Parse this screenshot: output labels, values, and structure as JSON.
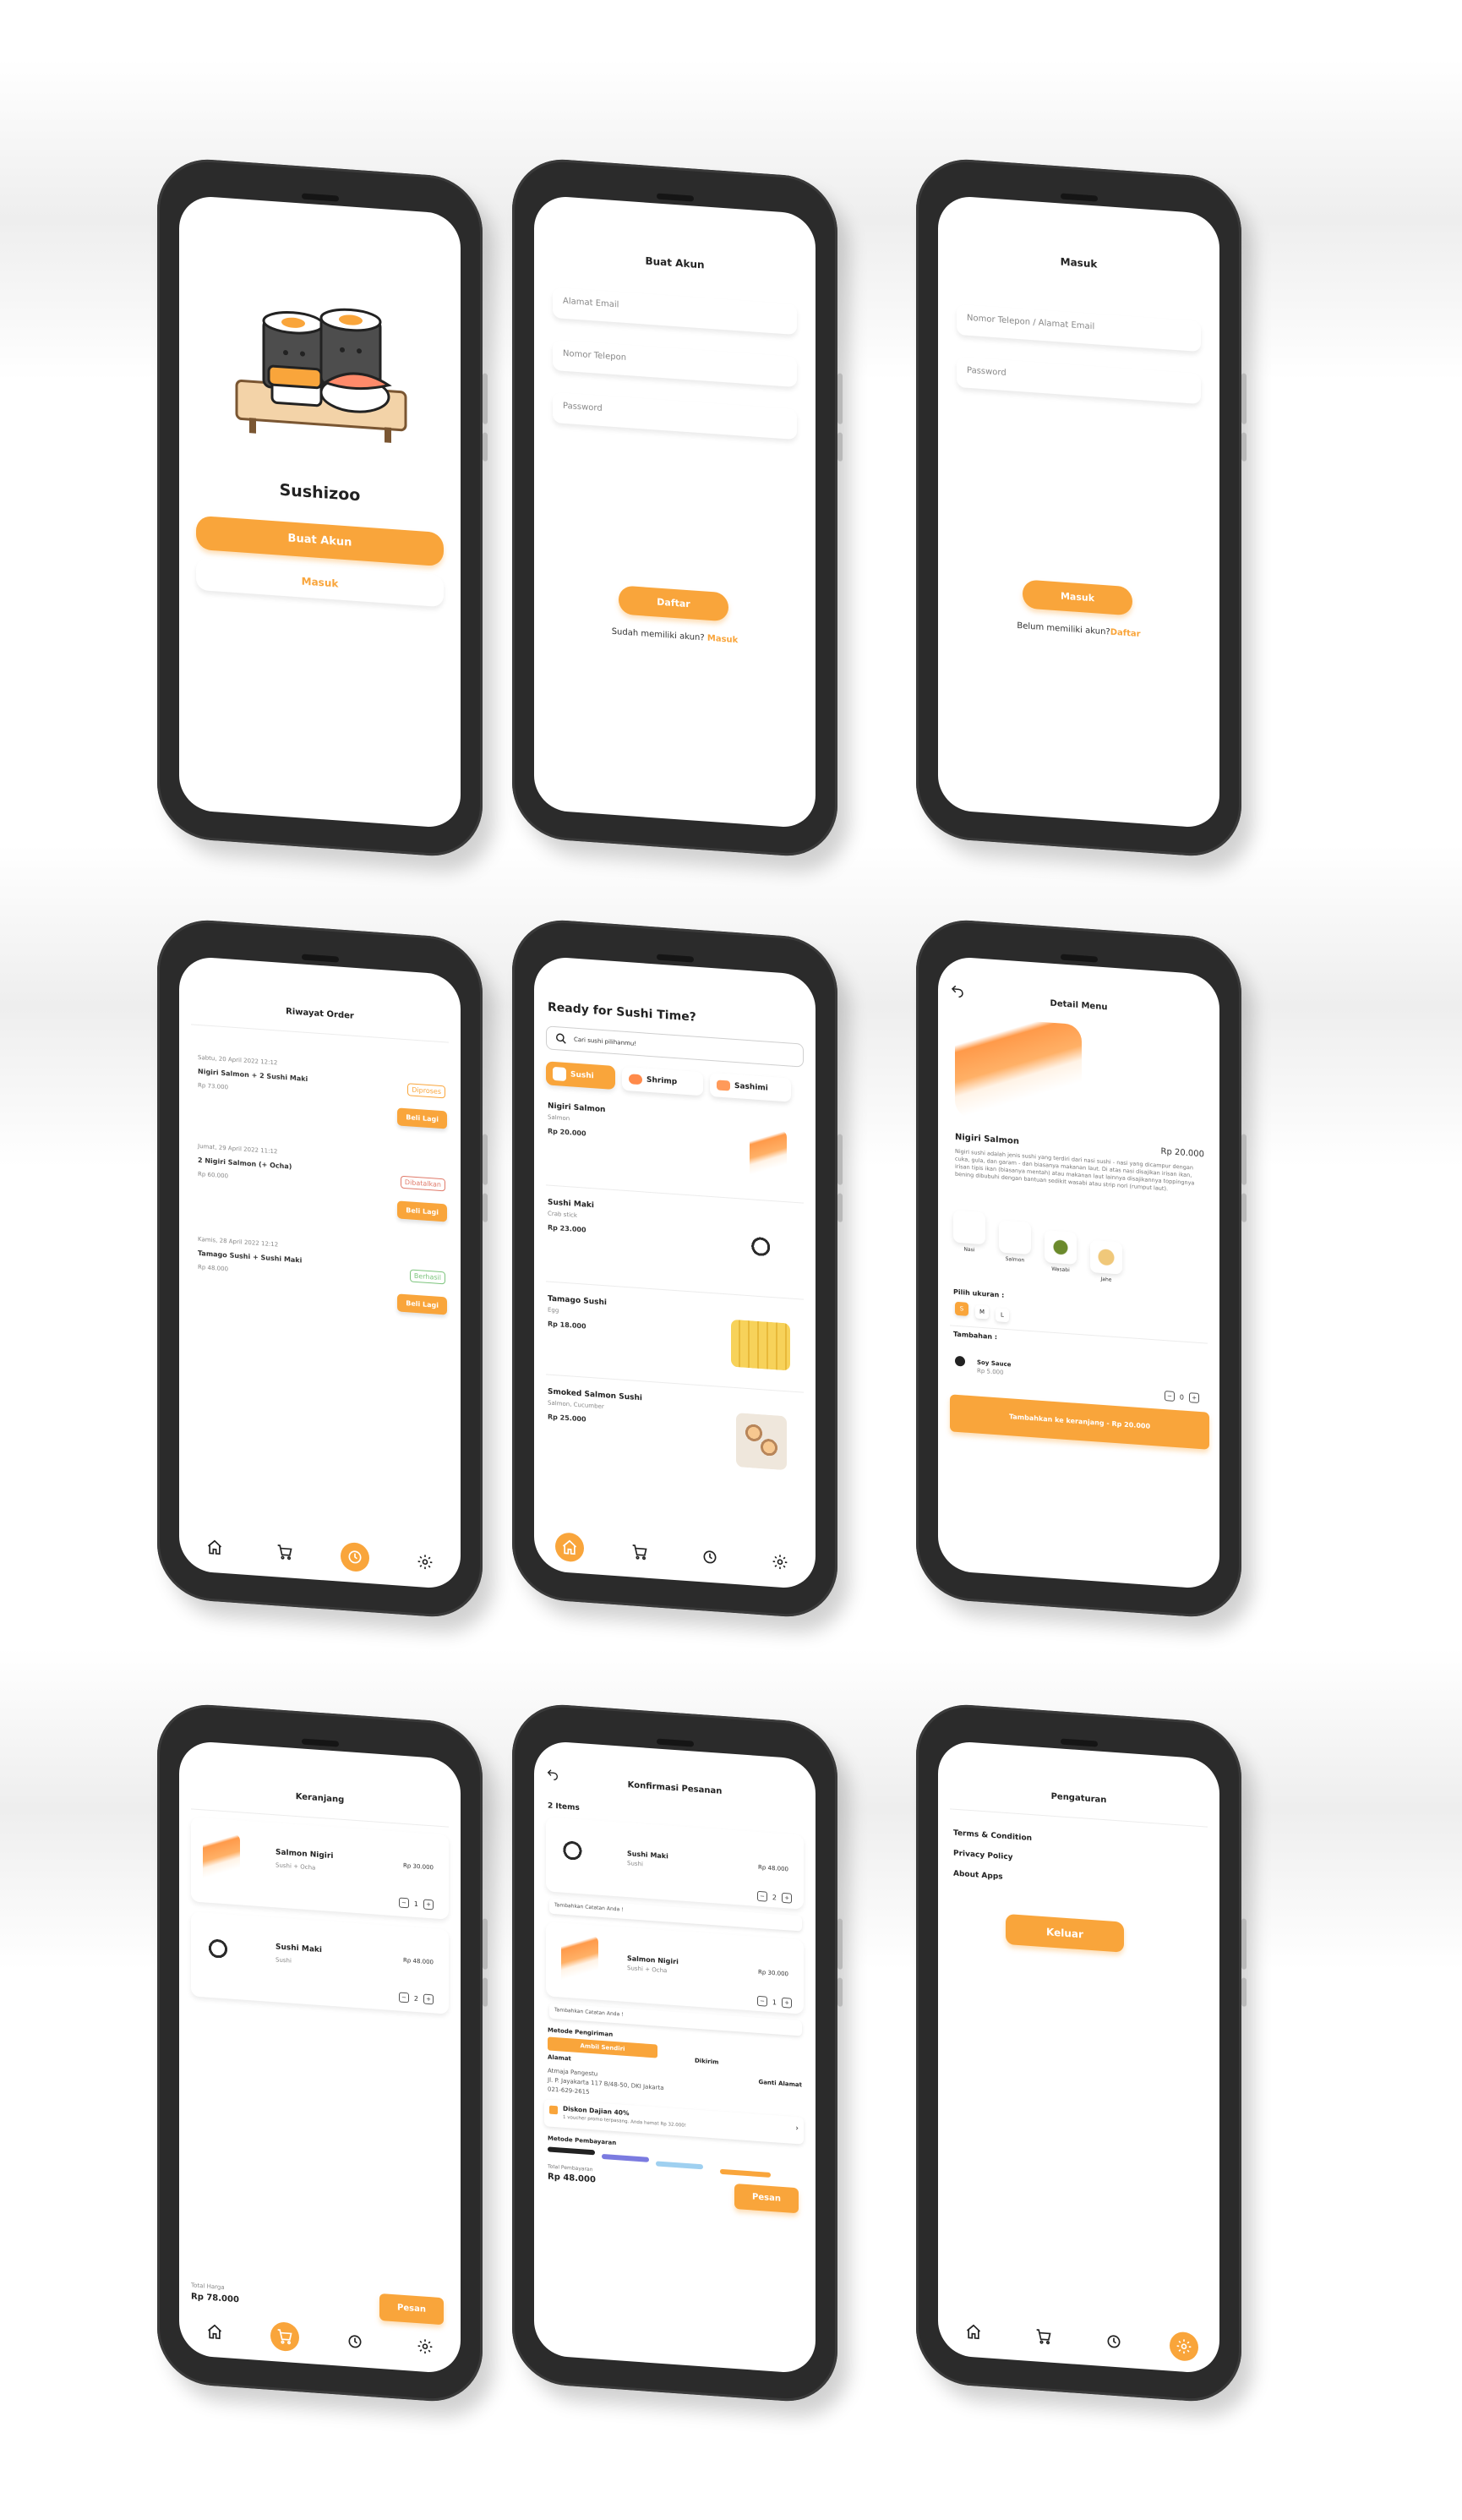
{
  "colors": {
    "accent": "#f9a53b",
    "success": "#7cc47c",
    "danger": "#e07a6a",
    "text": "#222222",
    "bezel": "#2b2b2b"
  },
  "welcome": {
    "app_name": "Sushizoo",
    "create_button": "Buat Akun",
    "login_button": "Masuk"
  },
  "register": {
    "title": "Buat Akun",
    "email_placeholder": "Alamat Email",
    "phone_placeholder": "Nomor Telepon",
    "password_placeholder": "Password",
    "submit": "Daftar",
    "has_account": "Sudah memiliki akun?",
    "login_link": "Masuk"
  },
  "login": {
    "title": "Masuk",
    "id_placeholder": "Nomor Telepon / Alamat Email",
    "password_placeholder": "Password",
    "submit": "Masuk",
    "no_account": "Belum memiliki akun?",
    "register_link": "Daftar"
  },
  "history": {
    "title": "Riwayat Order",
    "reorder": "Beli Lagi",
    "orders": [
      {
        "date": "Sabtu, 20 April 2022 12:12",
        "items": "Nigiri Salmon + 2 Sushi Maki",
        "price": "Rp 73.000",
        "status": "Diproses",
        "status_color": "#f9a53b"
      },
      {
        "date": "Jumat, 29 April 2022 11:12",
        "items": "2 Nigiri Salmon (+ Ocha)",
        "price": "Rp 60.000",
        "status": "Dibatalkan",
        "status_color": "#e07a6a"
      },
      {
        "date": "Kamis, 28 April 2022 12:12",
        "items": "Tamago Sushi + Sushi Maki",
        "price": "Rp 48.000",
        "status": "Berhasil",
        "status_color": "#7cc47c"
      }
    ]
  },
  "home": {
    "title": "Ready for Sushi Time?",
    "search_placeholder": "Cari sushi pilihanmu!",
    "categories": [
      "Sushi",
      "Shrimp",
      "Sashimi"
    ],
    "menu": [
      {
        "name": "Nigiri Salmon",
        "sub": "Salmon",
        "price": "Rp 20.000"
      },
      {
        "name": "Sushi Maki",
        "sub": "Crab stick",
        "price": "Rp 23.000"
      },
      {
        "name": "Tamago Sushi",
        "sub": "Egg",
        "price": "Rp 18.000"
      },
      {
        "name": "Smoked Salmon Sushi",
        "sub": "Salmon, Cucumber",
        "price": "Rp 25.000"
      }
    ]
  },
  "detail": {
    "title": "Detail Menu",
    "name": "Nigiri Salmon",
    "price": "Rp 20.000",
    "description": "Nigiri sushi adalah jenis sushi yang terdiri dari nasi sushi - nasi yang dicampur dengan cuka, gula, dan garam - dan biasanya makanan laut. Di atas nasi disajikan irisan ikan, irisan tipis ikan (biasanya mentah) atau makanan laut lainnya disajikannya toppingnya bening dibubuhi dengan bantuan sedikit wasabi atau strip nori (rumput laut).",
    "ingredients": [
      "Nasi",
      "Salmon",
      "Wasabi",
      "Jahe"
    ],
    "size_label": "Pilih ukuran :",
    "sizes": [
      "S",
      "M",
      "L"
    ],
    "extra_label": "Tambahan :",
    "extra_name": "Soy Sauce",
    "extra_price": "Rp 5.000",
    "extra_qty": "0",
    "cta": "Tambahkan ke keranjang - Rp 20.000"
  },
  "cart": {
    "title": "Keranjang",
    "items": [
      {
        "name": "Salmon Nigiri",
        "sub": "Sushi + Ocha",
        "price": "Rp 30.000",
        "qty": "1"
      },
      {
        "name": "Sushi Maki",
        "sub": "Sushi",
        "price": "Rp 48.000",
        "qty": "2"
      }
    ],
    "total_label": "Total Harga",
    "total": "Rp 78.000",
    "order_button": "Pesan"
  },
  "confirm": {
    "title": "Konfirmasi Pesanan",
    "count": "2 Items",
    "items": [
      {
        "name": "Sushi Maki",
        "sub": "Sushi",
        "price": "Rp 48.000",
        "qty": "2",
        "note": "Tambahkan Catatan Anda !"
      },
      {
        "name": "Salmon Nigiri",
        "sub": "Sushi + Ocha",
        "price": "Rp 30.000",
        "qty": "1",
        "note": "Tambahkan Catatan Anda !"
      }
    ],
    "shipping_label": "Metode Pengiriman",
    "pickup": "Ambil Sendiri",
    "delivery": "Dikirim",
    "address_label": "Alamat",
    "change_address": "Ganti Alamat",
    "address_name": "Atmaja Pangestu",
    "address_line": "Jl. P. Jayakarta 117 B/48-50, DKI Jakarta",
    "address_phone": "021-629-2615",
    "promo_title": "Diskon Dajian 40%",
    "promo_sub": "1 voucher promo terpasang. Anda hemat Rp 32.000!",
    "payment_label": "Metode Pembayaran",
    "total_label": "Total Pembayaran",
    "total": "Rp 48.000",
    "order_button": "Pesan"
  },
  "settings": {
    "title": "Pengaturan",
    "items": [
      "Terms & Condition",
      "Privacy Policy",
      "About Apps"
    ],
    "logout": "Keluar"
  }
}
